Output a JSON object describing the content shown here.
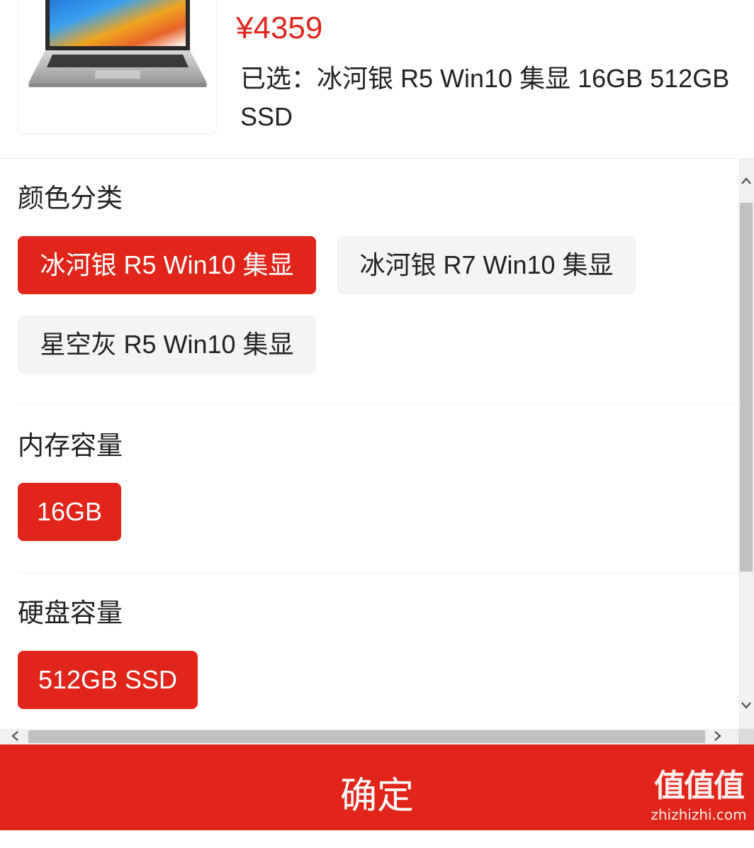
{
  "product": {
    "price": "¥4359",
    "selected_text": "已选：冰河银 R5 Win10 集显 16GB 512GB SSD",
    "image_icon": "laptop-image"
  },
  "color_section": {
    "title": "颜色分类",
    "options": [
      {
        "label": "冰河银 R5 Win10 集显",
        "selected": true
      },
      {
        "label": "冰河银 R7 Win10 集显",
        "selected": false
      },
      {
        "label": "星空灰 R5 Win10 集显",
        "selected": false
      }
    ]
  },
  "memory_section": {
    "title": "内存容量",
    "options": [
      {
        "label": "16GB",
        "selected": true
      }
    ]
  },
  "storage_section": {
    "title": "硬盘容量",
    "options": [
      {
        "label": "512GB SSD",
        "selected": true
      }
    ]
  },
  "footer": {
    "confirm_label": "确定"
  },
  "watermark": {
    "main": "值值值",
    "sub": "zhizhizhi.com"
  },
  "theme": {
    "accent": "#e1251b",
    "chip_inactive": "#f4f4f4"
  }
}
